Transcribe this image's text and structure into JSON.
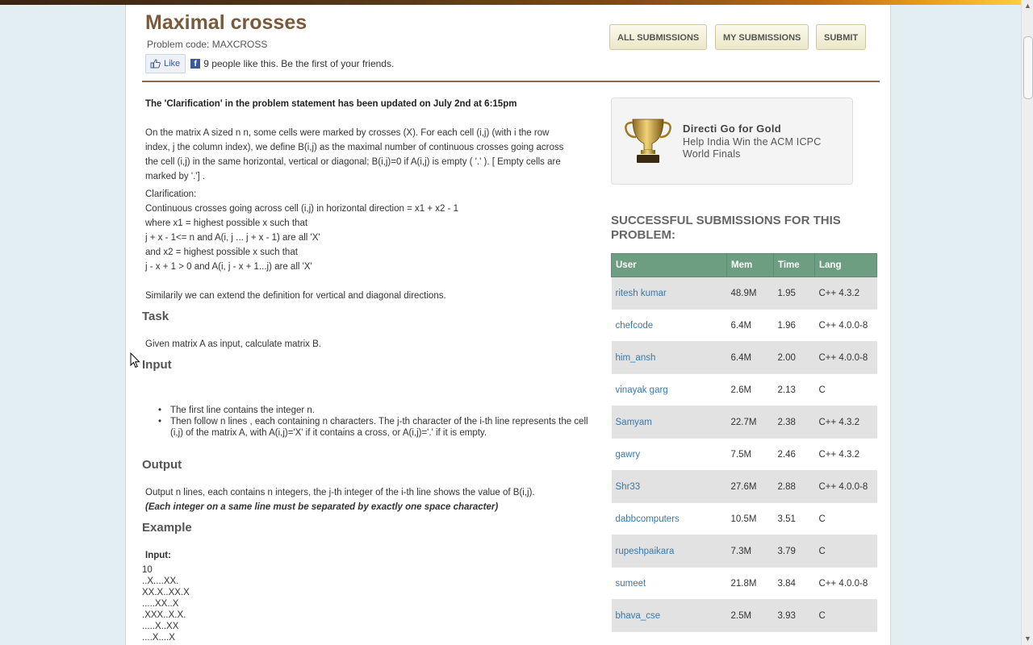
{
  "problem": {
    "title": "Maximal crosses",
    "code_text": "Problem code: MAXCROSS"
  },
  "like": {
    "button_label": "Like",
    "fb_glyph": "f",
    "text": "9 people like this. Be the first of your friends."
  },
  "header_buttons": {
    "all": "ALL SUBMISSIONS",
    "mine": "MY SUBMISSIONS",
    "submit": "SUBMIT"
  },
  "statement": {
    "notice": "The 'Clarification' in the problem statement has been updated on July 2nd at 6:15pm",
    "intro_lines": [
      "On the matrix A sized n n, some cells were marked by crosses (X). For each cell (i,j) (with i the row",
      "index, j the column index), we define B(i,j) as the maximal number of continuous crosses going across",
      "the cell (i,j) in the same horizontal, vertical or diagonal; B(i,j)=0 if A(i,j) is empty ( '.' ). [ Empty cells are",
      "marked by '.'] ."
    ],
    "clarification": [
      "Clarification:",
      "Continuous crosses going across cell (i,j) in horizontal direction = x1 + x2 - 1",
      "where x1 = highest possible x such that",
      "j + x - 1<= n and A(i, j ... j + x - 1) are all 'X'",
      "and x2 = highest possible x such that",
      "j - x + 1 > 0 and A(i, j - x + 1...j) are all 'X'"
    ],
    "similarly": "Similarily we can extend the definition for vertical and diagonal directions.",
    "task_heading": "Task",
    "task_text": "Given matrix A as input, calculate matrix B.",
    "input_heading": "Input",
    "input_items": [
      "The first line contains the integer n.",
      "Then follow n lines , each containing n characters. The j-th character of the i-th line represents the cell (i,j) of the matrix A, with A(i,j)='X' if it contains a cross, or A(i,j)='.' if it is empty."
    ],
    "output_heading": "Output",
    "output_text": "Output n lines, each contains n integers, the j-th integer of the i-th line shows the value of B(i,j).",
    "output_note": "(Each integer on a same line must be separated by exactly one space character)",
    "example_heading": "Example",
    "example_input_label": "Input:",
    "example_lines": [
      "10",
      "..X....XX.",
      "XX.X..XX.X",
      ".....XX..X",
      ".XXX..X.X.",
      ".....X..XX",
      "....X....X"
    ]
  },
  "sponsor": {
    "title": "Directi Go for Gold",
    "subtitle": "Help India Win the ACM ICPC World Finals"
  },
  "submissions": {
    "heading": "SUCCESSFUL SUBMISSIONS FOR THIS PROBLEM:",
    "columns": [
      "User",
      "Mem",
      "Time",
      "Lang"
    ],
    "rows": [
      [
        "ritesh kumar",
        "48.9M",
        "1.95",
        "C++ 4.3.2"
      ],
      [
        "chefcode",
        "6.4M",
        "1.96",
        "C++ 4.0.0-8"
      ],
      [
        "him_ansh",
        "6.4M",
        "2.00",
        "C++ 4.0.0-8"
      ],
      [
        "vinayak garg",
        "2.6M",
        "2.13",
        "C"
      ],
      [
        "Samyam",
        "22.7M",
        "2.38",
        "C++ 4.3.2"
      ],
      [
        "gawry",
        "7.5M",
        "2.46",
        "C++ 4.3.2"
      ],
      [
        "Shr33",
        "27.6M",
        "2.88",
        "C++ 4.0.0-8"
      ],
      [
        "dabbcomputers",
        "10.5M",
        "3.51",
        "C"
      ],
      [
        "rupeshpaikara",
        "7.3M",
        "3.79",
        "C"
      ],
      [
        "sumeet",
        "21.8M",
        "3.84",
        "C++ 4.0.0-8"
      ],
      [
        "bhava_cse",
        "2.5M",
        "3.93",
        "C"
      ]
    ]
  },
  "colors": {
    "title": "#7a5a3c",
    "table_header": "#6e9e82",
    "link": "#3a78a8"
  }
}
